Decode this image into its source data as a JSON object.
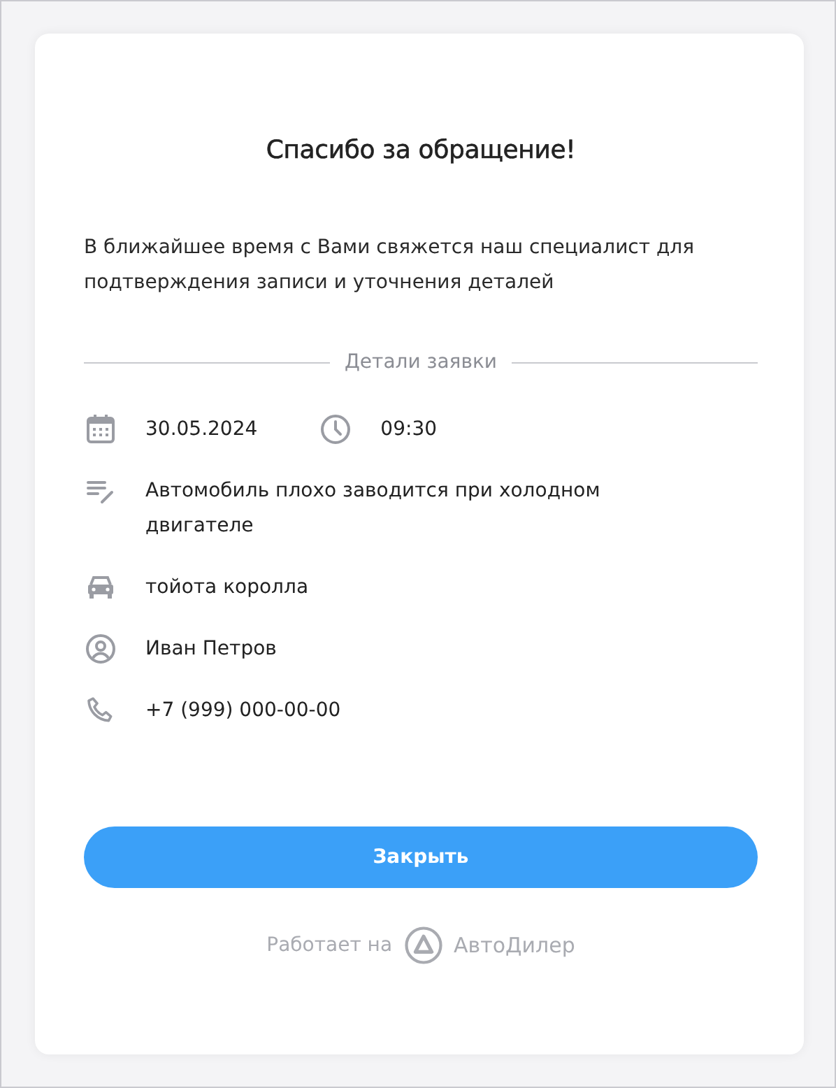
{
  "dialog": {
    "title": "Спасибо за обращение!",
    "message": "В ближайшее время с Вами свяжется наш специалист для подтверждения записи и уточнения деталей",
    "section_label": "Детали заявки",
    "details": [
      {
        "items": [
          {
            "kind": "date",
            "text": "30.05.2024"
          },
          {
            "kind": "time",
            "text": "09:30"
          }
        ]
      },
      {
        "items": [
          {
            "kind": "comment",
            "text": "Автомобиль плохо заводится при холодном двигателе"
          }
        ]
      },
      {
        "items": [
          {
            "kind": "vehicle",
            "text": "тойота королла"
          }
        ]
      },
      {
        "items": [
          {
            "kind": "client",
            "text": "Иван Петров"
          }
        ]
      },
      {
        "items": [
          {
            "kind": "phone",
            "text": "+7 (999) 000-00-00"
          }
        ]
      }
    ],
    "button": "Закрыть",
    "footer": {
      "powered_by": "Работает на",
      "brand": "АвтоДилер"
    }
  }
}
